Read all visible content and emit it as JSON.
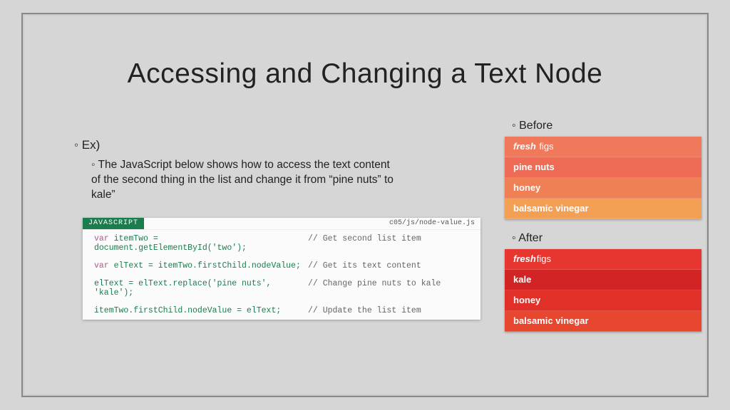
{
  "title": "Accessing and Changing a Text Node",
  "example": {
    "label": "Ex)",
    "text": "The JavaScript below shows how to access the text content of the second thing in the list and change it from “pine nuts” to kale”"
  },
  "code": {
    "tag": "JAVASCRIPT",
    "path": "c05/js/node-value.js",
    "lines": [
      {
        "kw": "var",
        "rest": " itemTwo = document.getElementById('two');",
        "comment": "// Get second list item"
      },
      {
        "kw": "var",
        "rest": " elText  = itemTwo.firstChild.nodeValue;",
        "comment": "// Get its text content"
      },
      {
        "kw": "",
        "rest": "elText = elText.replace('pine nuts', 'kale');",
        "comment": "// Change pine nuts to kale"
      },
      {
        "kw": "",
        "rest": "itemTwo.firstChild.nodeValue = elText;",
        "comment": "// Update the list item"
      }
    ]
  },
  "before": {
    "label": "Before",
    "items": [
      {
        "em": "fresh",
        "rest": " figs"
      },
      {
        "b": "pine nuts"
      },
      {
        "b": "honey"
      },
      {
        "b": "balsamic vinegar"
      }
    ]
  },
  "after": {
    "label": "After",
    "items": [
      {
        "em": "fresh",
        "rest": "figs"
      },
      {
        "b": "kale"
      },
      {
        "b": "honey"
      },
      {
        "b": "balsamic vinegar"
      }
    ]
  }
}
